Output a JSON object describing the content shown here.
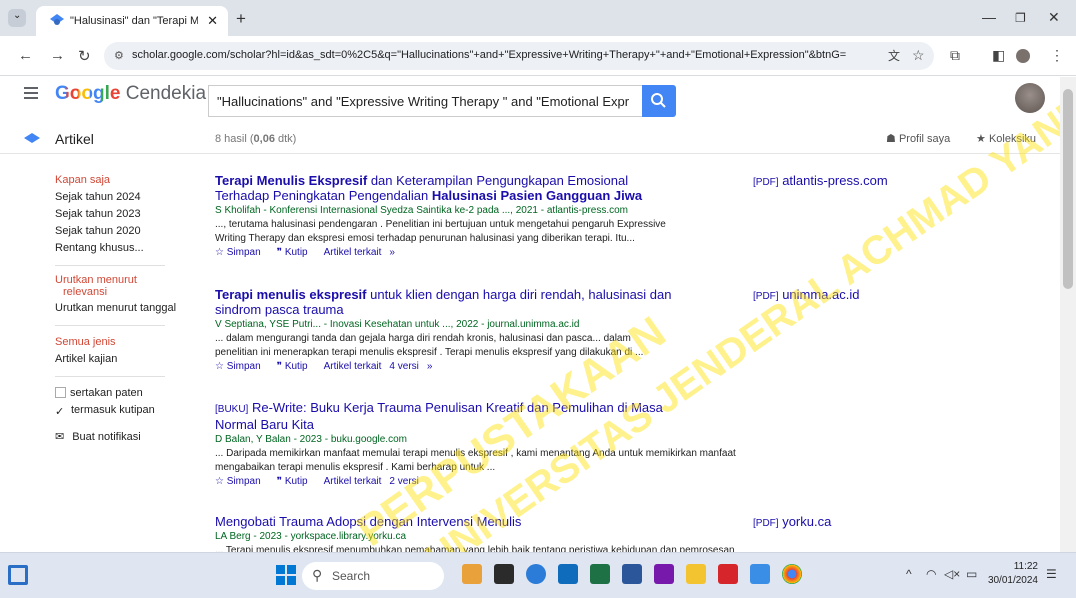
{
  "browser": {
    "tab_title": "\"Halusinasi\" dan \"Terapi Menuli",
    "url": "scholar.google.com/scholar?hl=id&as_sdt=0%2C5&q=\"Hallucinations\"+and+\"Expressive+Writing+Therapy+\"+and+\"Emotional+Expression\"&btnG="
  },
  "header": {
    "logo_google": "Google",
    "logo_suffix": " Cendekia",
    "search_value": "\"Hallucinations\" and \"Expressive Writing Therapy \" and \"Emotional Expression\""
  },
  "subbar": {
    "section": "Artikel",
    "count_prefix": "8 hasil (",
    "count_time": "0,06",
    "count_suffix": " dtk)",
    "profile": "Profil saya",
    "library": "Koleksiku"
  },
  "sidebar": {
    "time_filters": [
      "Kapan saja",
      "Sejak tahun 2024",
      "Sejak tahun 2023",
      "Sejak tahun 2020",
      "Rentang khusus..."
    ],
    "sort_relevance_1": "Urutkan menurut",
    "sort_relevance_2": "relevansi",
    "sort_date": "Urutkan menurut tanggal",
    "type_all": "Semua jenis",
    "type_review": "Artikel kajian",
    "patents": "sertakan paten",
    "citations": "termasuk kutipan",
    "alert": "Buat notifikasi"
  },
  "results": [
    {
      "title_bold": "Terapi Menulis Ekspresif",
      "title_rest1": " dan Keterampilan Pengungkapan Emosional",
      "title_line2a": "Terhadap Peningkatan Pengendalian ",
      "title_line2b": "Halusinasi Pasien Gangguan Jiwa",
      "authors": "S Kholifah - Konferensi Internasional Syedza Saintika ke-2 pada ..., 2021 - atlantis-press.com",
      "snippet1": "..., terutama halusinasi pendengaran . Penelitian ini bertujuan untuk mengetahui pengaruh Expressive",
      "snippet2": "Writing Therapy dan ekspresi emosi terhadap penurunan halusinasi yang diberikan terapi. Itu...",
      "save": "Simpan",
      "cite": "Kutip",
      "related": "Artikel terkait",
      "versions": "",
      "pdf_tag": "[PDF]",
      "pdf_site": "atlantis-press.com"
    },
    {
      "title_bold": "Terapi menulis ekspresif",
      "title_rest1": " untuk klien dengan harga diri rendah, halusinasi dan",
      "title_line2a": "sindrom pasca trauma",
      "title_line2b": "",
      "authors": "V Septiana, YSE Putri... - Inovasi Kesehatan untuk ..., 2022 - journal.unimma.ac.id",
      "snippet1": "... dalam mengurangi tanda dan gejala harga diri rendah kronis, halusinasi dan pasca... dalam",
      "snippet2": "penelitian ini menerapkan terapi menulis ekspresif . Terapi menulis ekspresif yang dilakukan di ...",
      "save": "Simpan",
      "cite": "Kutip",
      "related": "Artikel terkait",
      "versions": "4 versi",
      "pdf_tag": "[PDF]",
      "pdf_site": "unimma.ac.id"
    },
    {
      "book_tag": "[BUKU]",
      "title_rest1": " Re-Write: Buku Kerja Trauma Penulisan Kreatif dan Pemulihan di Masa",
      "title_line2a": "Normal Baru Kita",
      "authors": "D Balan, Y Balan - 2023 - buku.google.com",
      "snippet1": "... Daripada memikirkan manfaat memulai terapi menulis ekspresif , kami menantang Anda untuk memikirkan manfaat",
      "snippet2": "mengabaikan terapi menulis ekspresif . Kami berharap untuk ...",
      "save": "Simpan",
      "cite": "Kutip",
      "related": "Artikel terkait",
      "versions": "2 versi"
    },
    {
      "title_rest1": "Mengobati Trauma Adopsi dengan Intervensi Menulis",
      "authors": "LA Berg - 2023 - yorkspace.library.yorku.ca",
      "snippet1": "... Terapi menulis ekspresif menumbuhkan pemahaman yang lebih baik tentang peristiwa kehidupan dan pemrosesan",
      "pdf_tag": "[PDF]",
      "pdf_site": "yorku.ca"
    }
  ],
  "watermark": {
    "line1": "PERPUSTAKAAN",
    "line2": "UNIVERSITAS JENDERAL ACHMAD YANI"
  },
  "taskbar": {
    "search": "Search",
    "time": "11:22",
    "date": "30/01/2024"
  },
  "colors": {
    "link": "#1a0dab",
    "green": "#006621",
    "red": "#d14836",
    "accent": "#4285f4"
  }
}
